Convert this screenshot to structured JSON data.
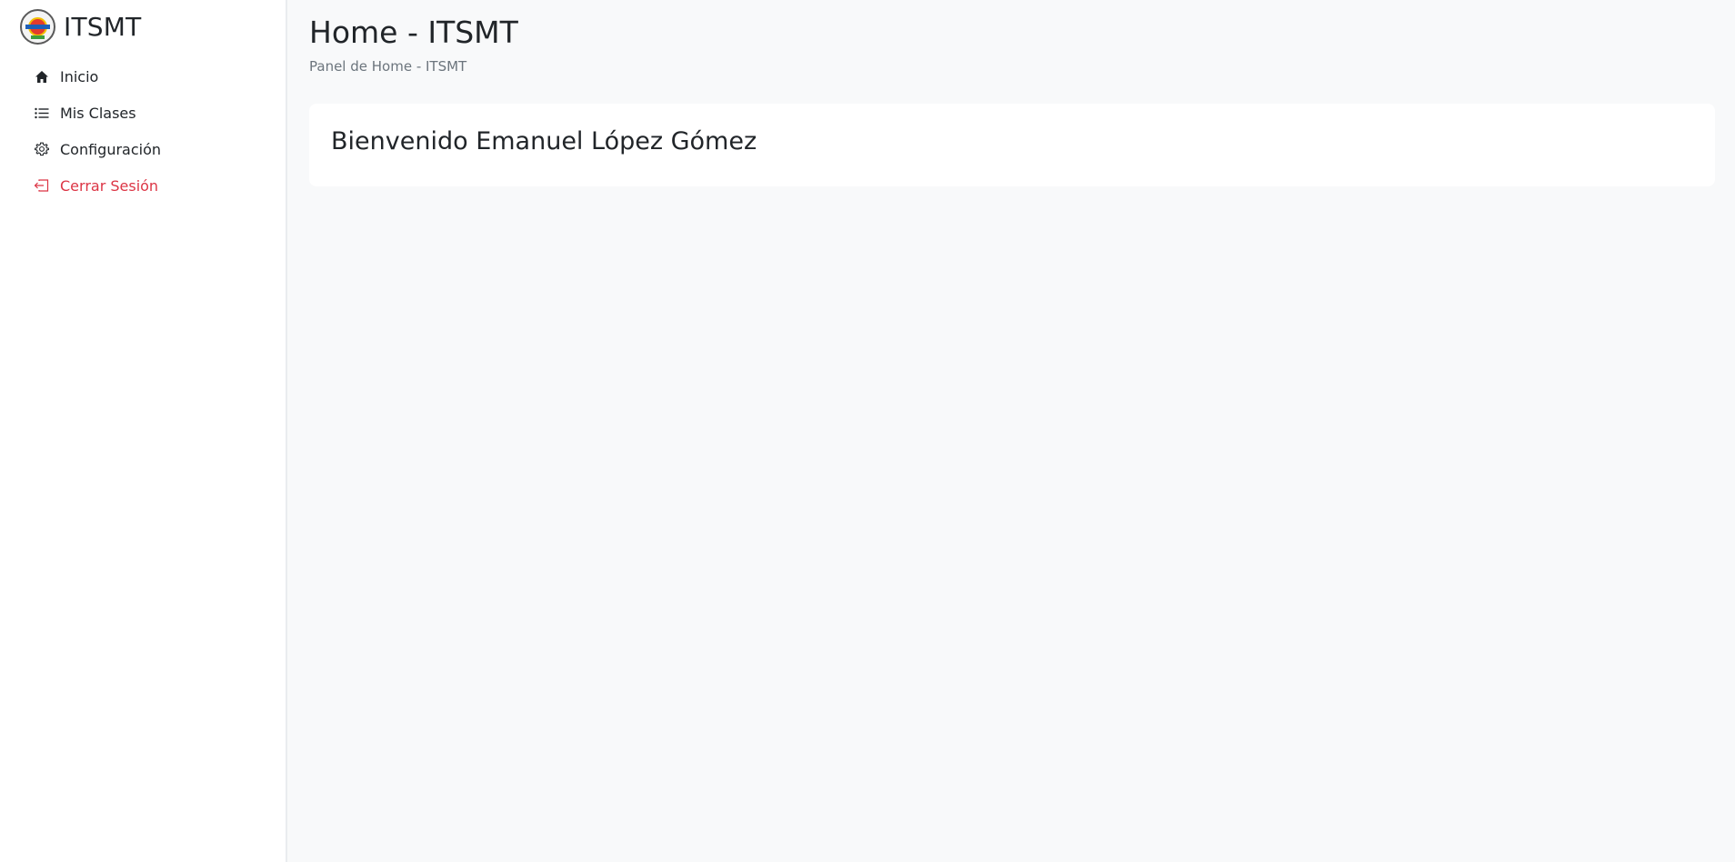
{
  "brand": {
    "title": "ITSMT"
  },
  "sidebar": {
    "items": [
      {
        "label": "Inicio",
        "icon": "home-icon"
      },
      {
        "label": "Mis Clases",
        "icon": "list-icon"
      },
      {
        "label": "Configuración",
        "icon": "gear-icon"
      },
      {
        "label": "Cerrar Sesión",
        "icon": "logout-icon"
      }
    ]
  },
  "header": {
    "title": "Home - ITSMT",
    "subtitle": "Panel de Home - ITSMT"
  },
  "main": {
    "welcome": "Bienvenido Emanuel López Gómez"
  },
  "colors": {
    "background": "#f8f9fa",
    "text": "#212529",
    "muted": "#6c757d",
    "danger": "#dc3545"
  }
}
